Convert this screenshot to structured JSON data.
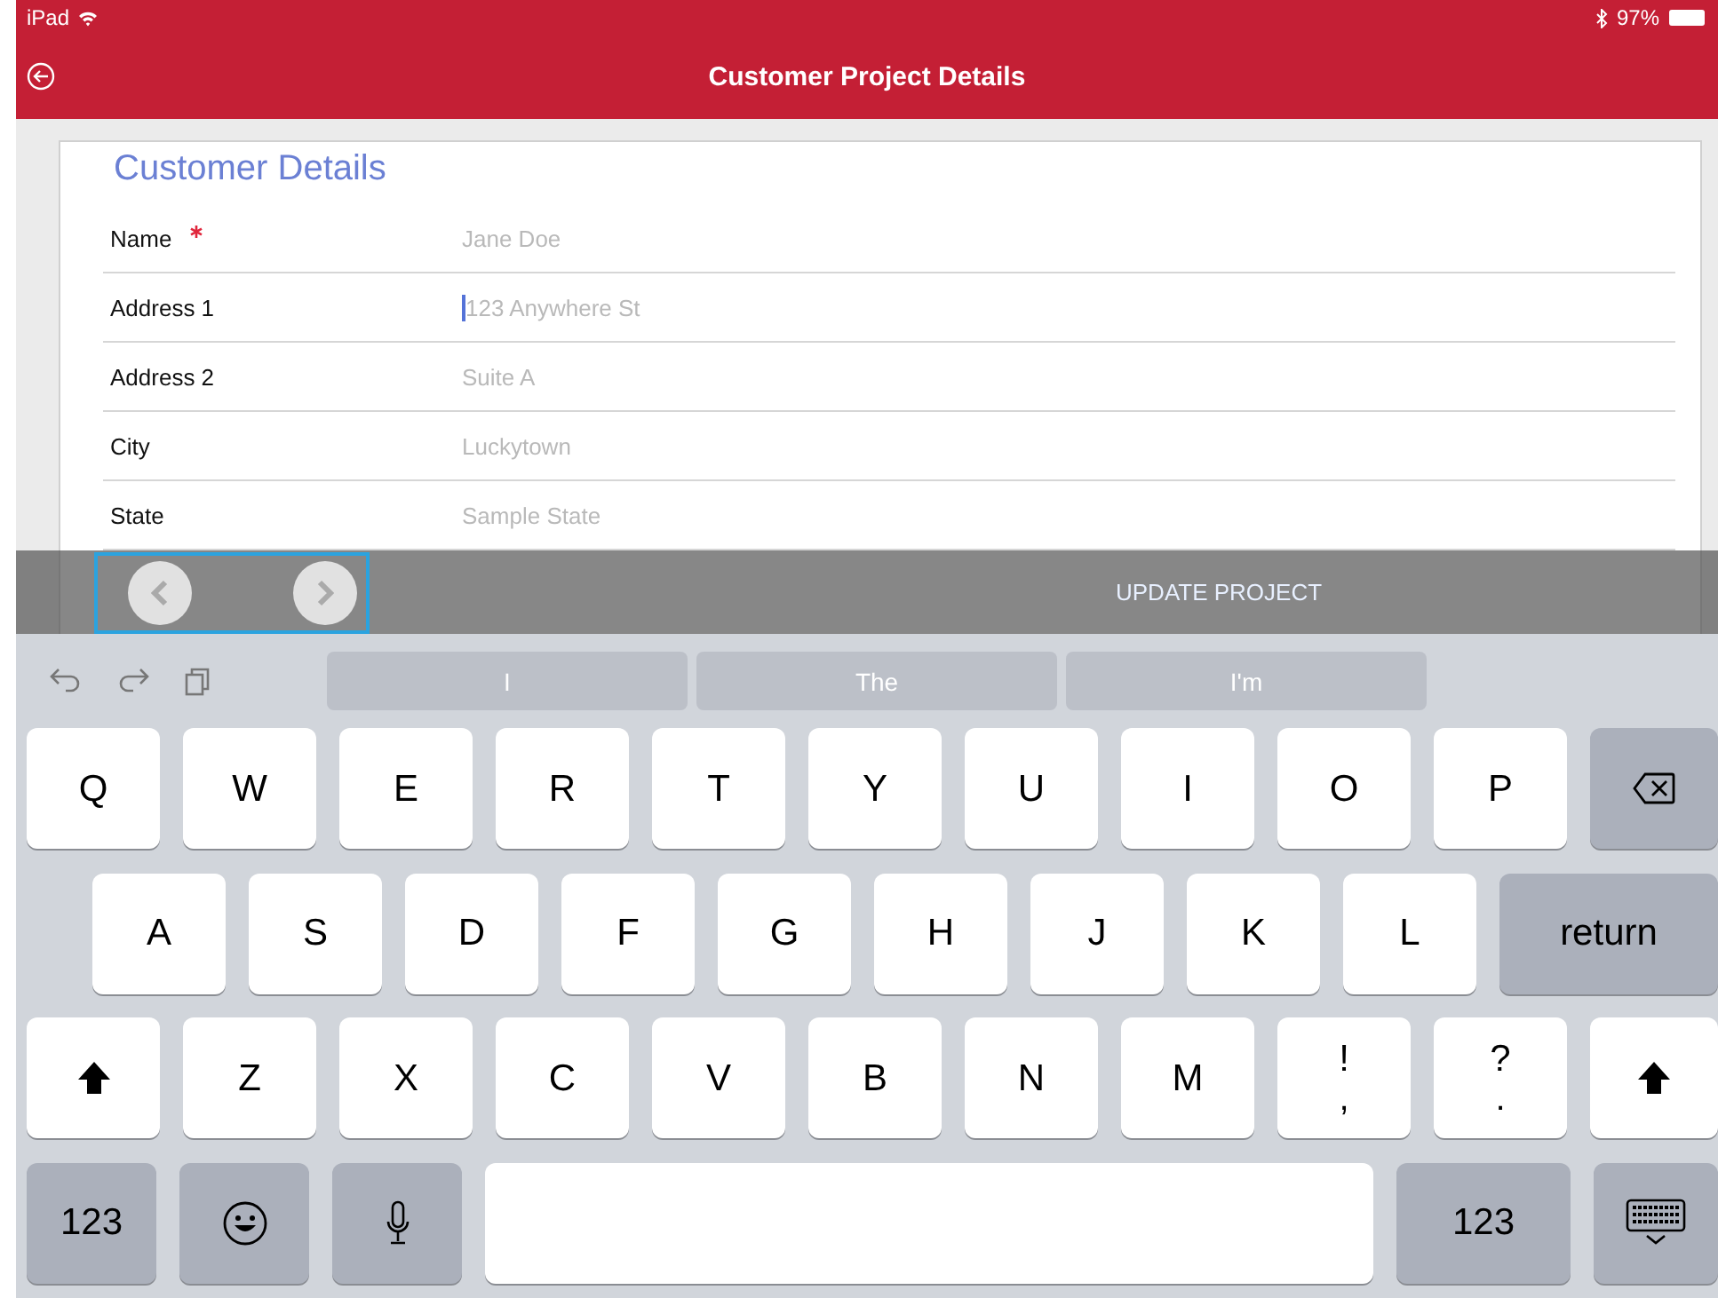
{
  "status_bar": {
    "device": "iPad",
    "battery": "97%"
  },
  "nav": {
    "title": "Customer Project Details"
  },
  "form": {
    "title": "Customer Details",
    "fields": [
      {
        "label": "Name",
        "required": true,
        "placeholder": "Jane Doe",
        "focused": false
      },
      {
        "label": "Address 1",
        "required": false,
        "placeholder": "123 Anywhere St",
        "focused": true
      },
      {
        "label": "Address 2",
        "required": false,
        "placeholder": "Suite A",
        "focused": false
      },
      {
        "label": "City",
        "required": false,
        "placeholder": "Luckytown",
        "focused": false
      },
      {
        "label": "State",
        "required": false,
        "placeholder": "Sample State",
        "focused": false
      }
    ]
  },
  "accessory": {
    "action": "UPDATE PROJECT"
  },
  "keyboard": {
    "suggestions": [
      "I",
      "The",
      "I'm"
    ],
    "rows": [
      {
        "keys": [
          {
            "kind": "letter",
            "label": "Q"
          },
          {
            "kind": "letter",
            "label": "W"
          },
          {
            "kind": "letter",
            "label": "E"
          },
          {
            "kind": "letter",
            "label": "R"
          },
          {
            "kind": "letter",
            "label": "T"
          },
          {
            "kind": "letter",
            "label": "Y"
          },
          {
            "kind": "letter",
            "label": "U"
          },
          {
            "kind": "letter",
            "label": "I"
          },
          {
            "kind": "letter",
            "label": "O"
          },
          {
            "kind": "letter",
            "label": "P"
          },
          {
            "kind": "backspace"
          }
        ]
      },
      {
        "keys": [
          {
            "kind": "letter",
            "label": "A"
          },
          {
            "kind": "letter",
            "label": "S"
          },
          {
            "kind": "letter",
            "label": "D"
          },
          {
            "kind": "letter",
            "label": "F"
          },
          {
            "kind": "letter",
            "label": "G"
          },
          {
            "kind": "letter",
            "label": "H"
          },
          {
            "kind": "letter",
            "label": "J"
          },
          {
            "kind": "letter",
            "label": "K"
          },
          {
            "kind": "letter",
            "label": "L"
          },
          {
            "kind": "mod",
            "label": "return"
          }
        ]
      },
      {
        "keys": [
          {
            "kind": "shift"
          },
          {
            "kind": "letter",
            "label": "Z"
          },
          {
            "kind": "letter",
            "label": "X"
          },
          {
            "kind": "letter",
            "label": "C"
          },
          {
            "kind": "letter",
            "label": "V"
          },
          {
            "kind": "letter",
            "label": "B"
          },
          {
            "kind": "letter",
            "label": "N"
          },
          {
            "kind": "letter",
            "label": "M"
          },
          {
            "kind": "letter",
            "label": "!",
            "alt": ","
          },
          {
            "kind": "letter",
            "label": "?",
            "alt": "."
          },
          {
            "kind": "shift"
          }
        ]
      },
      {
        "keys": [
          {
            "kind": "mod",
            "label": "123"
          },
          {
            "kind": "emoji"
          },
          {
            "kind": "mic"
          },
          {
            "kind": "space"
          },
          {
            "kind": "mod",
            "label": "123"
          },
          {
            "kind": "dismiss"
          }
        ]
      }
    ]
  }
}
